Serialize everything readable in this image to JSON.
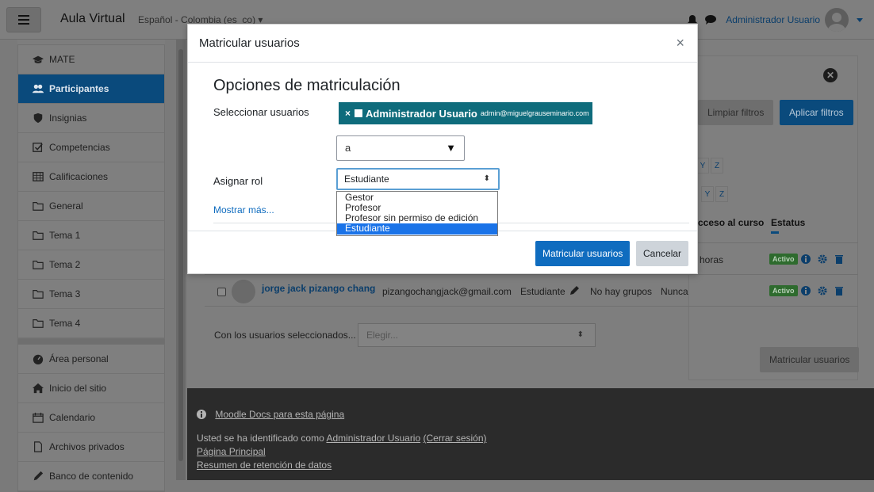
{
  "navbar": {
    "brand": "Aula Virtual",
    "language": "Español - Colombia (es_co) ▾",
    "user_name": "Administrador Usuario"
  },
  "drawer": {
    "items": [
      {
        "label": "MATE",
        "icon": "graduation-cap-icon"
      },
      {
        "label": "Participantes",
        "icon": "users-icon",
        "active": true
      },
      {
        "label": "Insignias",
        "icon": "shield-icon"
      },
      {
        "label": "Competencias",
        "icon": "checkbox-icon"
      },
      {
        "label": "Calificaciones",
        "icon": "table-icon"
      },
      {
        "label": "General",
        "icon": "folder-icon"
      },
      {
        "label": "Tema 1",
        "icon": "folder-icon"
      },
      {
        "label": "Tema 2",
        "icon": "folder-icon"
      },
      {
        "label": "Tema 3",
        "icon": "folder-icon"
      },
      {
        "label": "Tema 4",
        "icon": "folder-icon"
      }
    ],
    "secondary": [
      {
        "label": "Área personal",
        "icon": "dashboard-icon"
      },
      {
        "label": "Inicio del sitio",
        "icon": "home-icon"
      },
      {
        "label": "Calendario",
        "icon": "calendar-icon"
      },
      {
        "label": "Archivos privados",
        "icon": "file-icon"
      },
      {
        "label": "Banco de contenido",
        "icon": "pencil-icon"
      }
    ]
  },
  "background_page": {
    "limpiar_filtros": "Limpiar filtros",
    "aplicar_filtros": "Aplicar filtros",
    "letters_row1": [
      "Y",
      "Z"
    ],
    "letters_row2": [
      "Y",
      "Z"
    ],
    "col_last_access": "cceso al curso",
    "col_status": "Estatus",
    "row1": {
      "last_access": "horas",
      "status": "Activo"
    },
    "row2": {
      "name": "jorge jack pizango chang",
      "email": "pizangochangjack@gmail.com",
      "role": "Estudiante",
      "groups": "No hay grupos",
      "last_access": "Nunca",
      "status": "Activo"
    },
    "bulk_label": "Con los usuarios seleccionados...",
    "bulk_placeholder": "Elegir...",
    "enrol_button": "Matricular usuarios"
  },
  "footer": {
    "docs_link": "Moodle Docs para esta página",
    "logged_in_prefix": "Usted se ha identificado como ",
    "logged_in_user": "Administrador Usuario",
    "logout": "(Cerrar sesión)",
    "home": "Página Principal",
    "data_retention": "Resumen de retención de datos"
  },
  "modal": {
    "title": "Matricular usuarios",
    "close": "×",
    "section_title": "Opciones de matriculación",
    "select_users_label": "Seleccionar usuarios",
    "selected_user": {
      "name": "Administrador Usuario",
      "email": "admin@miguelgrauseminario.com"
    },
    "search_value": "a",
    "assign_role_label": "Asignar rol",
    "role_value": "Estudiante",
    "role_options": [
      "Gestor",
      "Profesor",
      "Profesor sin permiso de edición",
      "Estudiante"
    ],
    "role_selected_index": 3,
    "show_more": "Mostrar más...",
    "primary_button": "Matricular usuarios",
    "cancel_button": "Cancelar"
  },
  "colors": {
    "primary": "#0f6cbf",
    "chip": "#0f6c7c",
    "drawer_active": "#0a4a7c",
    "footer_bg": "#2b2b2b"
  }
}
